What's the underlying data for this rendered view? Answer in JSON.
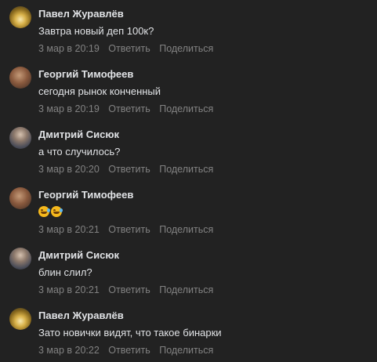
{
  "comments": [
    {
      "author": "Павел Журавлёв",
      "avatar": "pavel",
      "text": "Завтра новый деп 100к?",
      "date": "3 мар в 20:19",
      "reply": "Ответить",
      "share": "Поделиться"
    },
    {
      "author": "Георгий Тимофеев",
      "avatar": "georgiy",
      "text": "сегодня рынок конченный",
      "date": "3 мар в 20:19",
      "reply": "Ответить",
      "share": "Поделиться"
    },
    {
      "author": "Дмитрий Сисюк",
      "avatar": "dmitriy",
      "text": "а что случилось?",
      "date": "3 мар в 20:20",
      "reply": "Ответить",
      "share": "Поделиться"
    },
    {
      "author": "Георгий Тимофеев",
      "avatar": "georgiy",
      "text": "",
      "emojis": [
        "rolling-on-floor-laughing-icon",
        "rolling-on-floor-laughing-icon"
      ],
      "date": "3 мар в 20:21",
      "reply": "Ответить",
      "share": "Поделиться"
    },
    {
      "author": "Дмитрий Сисюк",
      "avatar": "dmitriy",
      "text": "блин слил?",
      "date": "3 мар в 20:21",
      "reply": "Ответить",
      "share": "Поделиться"
    },
    {
      "author": "Павел Журавлёв",
      "avatar": "pavel",
      "text": "Зато новички видят, что такое бинарки",
      "date": "3 мар в 20:22",
      "reply": "Ответить",
      "share": "Поделиться"
    }
  ],
  "colors": {
    "background": "#222222",
    "author": "#e1e3e6",
    "text": "#e1e3e6",
    "meta": "#828282"
  }
}
